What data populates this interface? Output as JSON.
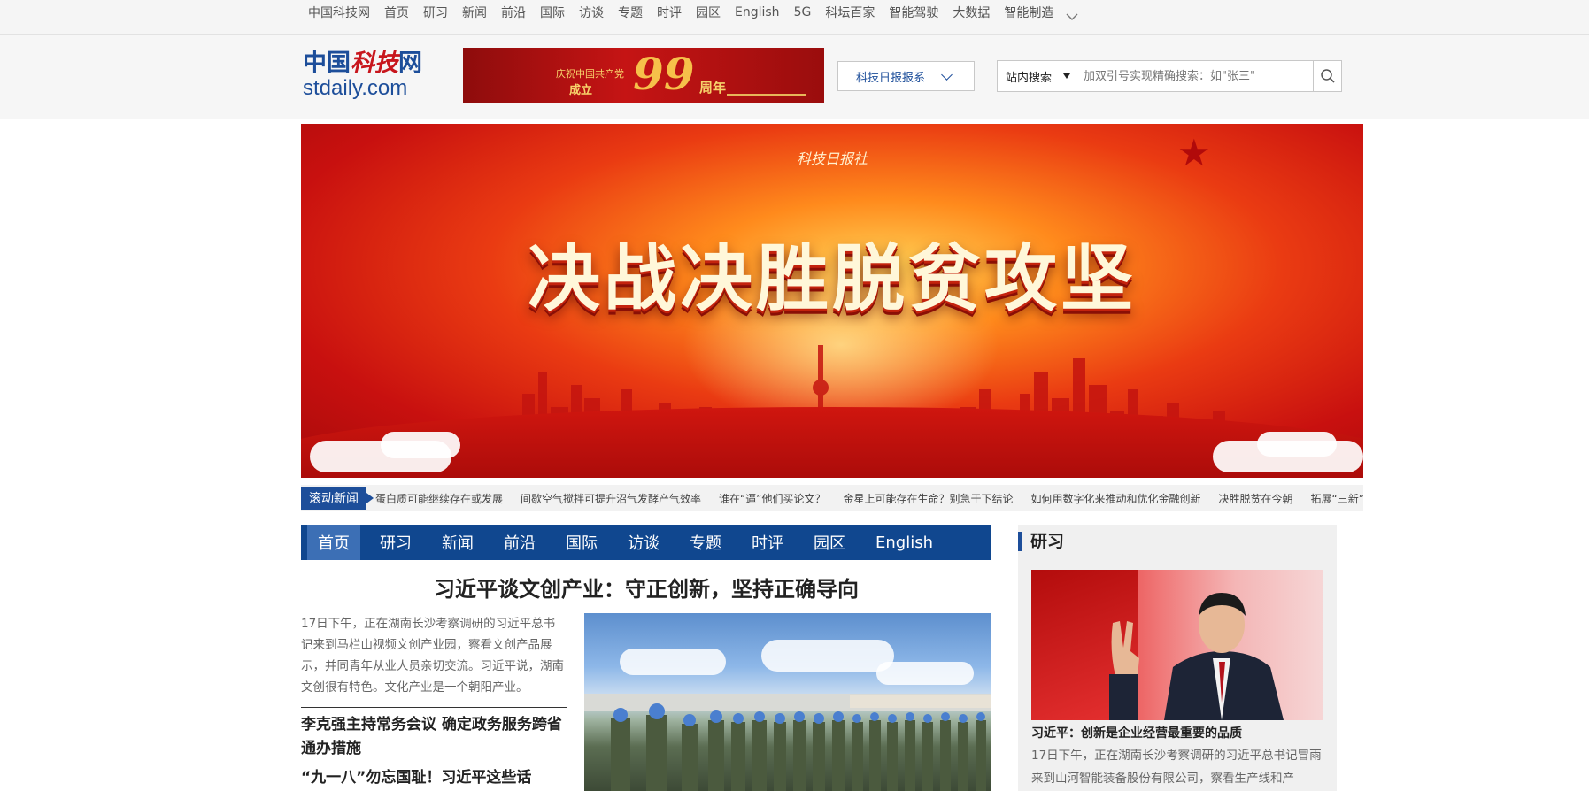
{
  "topnav": {
    "items": [
      "中国科技网",
      "首页",
      "研习",
      "新闻",
      "前沿",
      "国际",
      "访谈",
      "专题",
      "时评",
      "园区",
      "English",
      "5G",
      "科坛百家",
      "智能驾驶",
      "大数据",
      "智能制造"
    ],
    "more_icon": "chevron-down-icon"
  },
  "header": {
    "logo_cn_a": "中国",
    "logo_cn_b": "科技",
    "logo_cn_c": "网",
    "logo_en": "stdaily.com",
    "ad": {
      "line1": "庆祝中国共产党",
      "line2": "成立",
      "number": "99",
      "line3": "周年"
    },
    "paper_select": "科技日报报系",
    "search_scope": "站内搜索",
    "search_placeholder": "加双引号实现精确搜索：如\"张三\"",
    "search_icon": "search-icon"
  },
  "hero": {
    "publisher": "科技日报社",
    "headline": "决战决胜脱贫攻坚",
    "colors": {
      "deep_red": "#a50a0a",
      "orange": "#ff8a1c",
      "gold": "#ffcf54"
    }
  },
  "ticker": {
    "label": "滚动新闻",
    "items": [
      "蛋白质可能继续存在或发展",
      "间歇空气搅拌可提升沼气发酵产气效率",
      "谁在“逼”他们买论文？",
      "金星上可能存在生命？别急于下结论",
      "如何用数字化来推动和优化金融创新",
      "决胜脱贫在今朝",
      "拓展“三新”"
    ]
  },
  "mainnav": {
    "items": [
      "首页",
      "研习",
      "新闻",
      "前沿",
      "国际",
      "访谈",
      "专题",
      "时评",
      "园区",
      "English"
    ],
    "active_index": 0,
    "color": "#10478f"
  },
  "main": {
    "lead_title": "习近平谈文创产业：守正创新，坚持正确导向",
    "summary": "17日下午，正在湖南长沙考察调研的习近平总书记来到马栏山视频文创产业园，察看文创产品展示，并同青年从业人员亲切交流。习近平说，湖南文创很有特色。文化产业是一个朝阳产业。",
    "news": [
      "李克强主持常务会议 确定政务服务跨省通办措施",
      "“九一八”勿忘国耻！习近平这些话"
    ]
  },
  "sidebar": {
    "title": "研习",
    "caption": "习近平：创新是企业经营最重要的品质",
    "text": "17日下午，正在湖南长沙考察调研的习近平总书记冒雨来到山河智能装备股份有限公司，察看生产线和产"
  }
}
